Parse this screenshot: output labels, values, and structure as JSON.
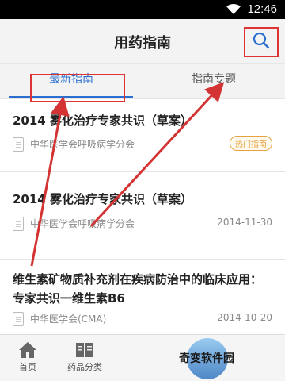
{
  "status": {
    "time": "12:46"
  },
  "header": {
    "title": "用药指南"
  },
  "tabs": [
    {
      "label": "最新指南",
      "active": true
    },
    {
      "label": "指南专题",
      "active": false
    }
  ],
  "items": [
    {
      "title": "2014 雾化治疗专家共识（草案）",
      "source": "中华医学会呼吸病学分会",
      "date": "",
      "badge": "热门指南"
    },
    {
      "title": "2014 雾化治疗专家共识（草案）",
      "source": "中华医学会呼吸病学分会",
      "date": "2014-11-30",
      "badge": ""
    },
    {
      "title": "维生素矿物质补充剂在疾病防治中的临床应用：专家共识一维生素B6",
      "source": "中华医学会(CMA)",
      "date": "2014-10-20",
      "badge": ""
    }
  ],
  "bottom_nav": {
    "home": "首页",
    "categories": "药品分类",
    "brand": "奇变软件园"
  },
  "colors": {
    "accent": "#2a6fcf",
    "annotation": "#d33333",
    "badge": "#e6a23c"
  }
}
